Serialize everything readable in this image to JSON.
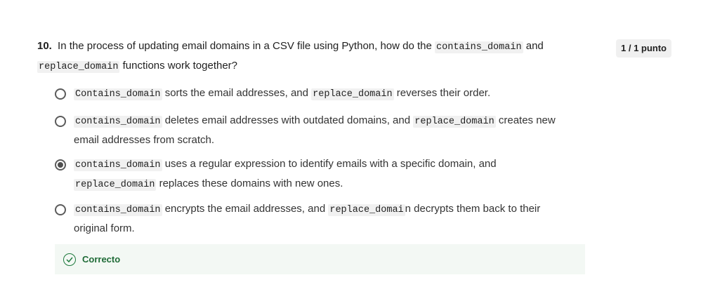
{
  "question": {
    "number": "10.",
    "text_1": "In the process of updating email domains in a CSV file using Python, how do the",
    "code_1": "contains_domain",
    "text_2": "and",
    "code_2": "replace_domain",
    "text_3": "functions work together?"
  },
  "score": "1 / 1 punto",
  "options": [
    {
      "code_a": "Contains_domain",
      "text_a": "sorts the email addresses, and",
      "code_b": "replace_domain",
      "text_b": "reverses their order.",
      "selected": false
    },
    {
      "code_a": "contains_domain",
      "text_a": "deletes email addresses with outdated domains, and",
      "code_b": "replace_domain",
      "text_b": "creates new email addresses from scratch.",
      "selected": false
    },
    {
      "code_a": "contains_domain",
      "text_a": "uses a regular expression to identify emails with a specific domain, and",
      "code_b": "replace_domain",
      "text_b": "replaces these domains with new ones.",
      "selected": true
    },
    {
      "code_a": "contains_domain",
      "text_a": "encrypts the email addresses, and",
      "code_b": "replace_domai",
      "text_b": "n decrypts them back to their original form.",
      "selected": false
    }
  ],
  "feedback": {
    "label": "Correcto",
    "icon": "check-circle-icon",
    "color": "#1f7a3e"
  }
}
